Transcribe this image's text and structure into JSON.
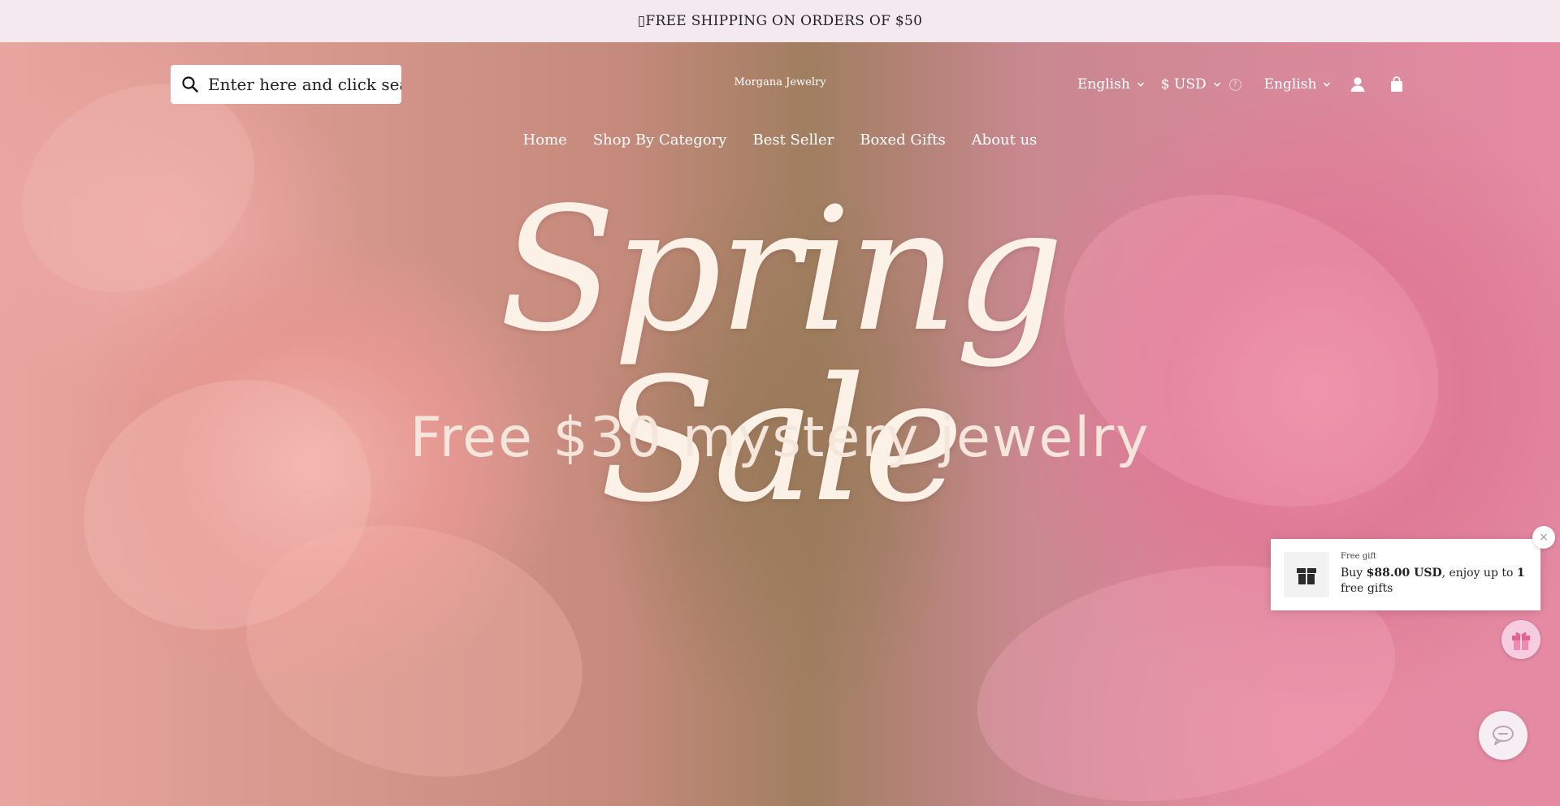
{
  "announcement": {
    "text": "▯FREE SHIPPING ON ORDERS OF $50"
  },
  "header": {
    "search_placeholder": "Enter here and click search",
    "logo": "Morgana Jewelry",
    "language_1": "English",
    "currency": "$ USD",
    "language_2": "English"
  },
  "nav": {
    "items": [
      "Home",
      "Shop By Category",
      "Best Seller",
      "Boxed Gifts",
      "About us"
    ]
  },
  "hero": {
    "headline": "Spring Sale",
    "subheadline": "Free $30 mystery jewelry"
  },
  "gift_popup": {
    "label": "Free gift",
    "text_prefix": "Buy ",
    "amount": "$88.00 USD",
    "text_middle": ", enjoy up to ",
    "count": "1",
    "text_suffix": " free gifts",
    "close": "×"
  },
  "colors": {
    "announcement_bg": "#f3e9ee",
    "nav_text": "#ffffff",
    "headline": "#fbf1e6"
  }
}
